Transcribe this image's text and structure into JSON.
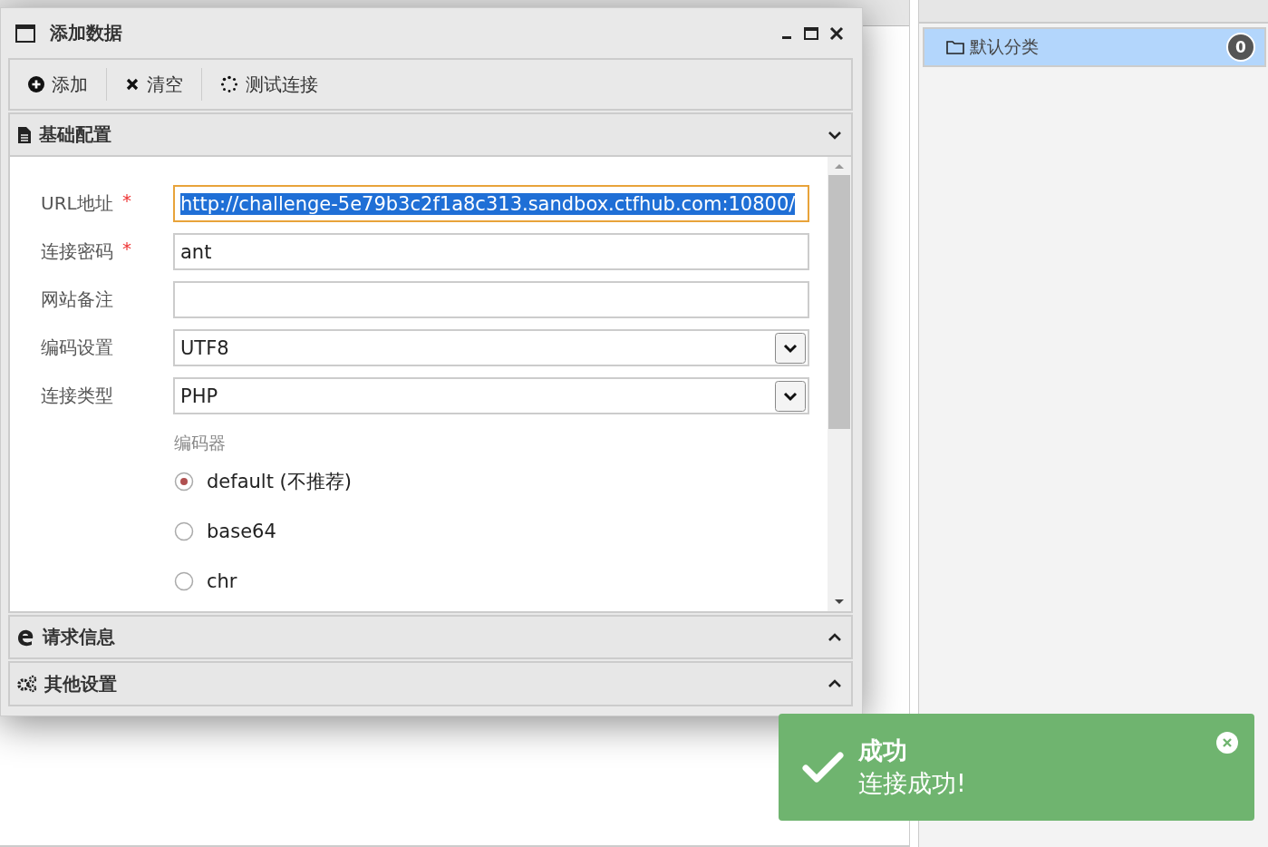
{
  "categories": [
    {
      "label": "默认分类",
      "count": "0",
      "selected": true
    }
  ],
  "dialog": {
    "title": "添加数据",
    "toolbar": [
      {
        "label": "添加"
      },
      {
        "label": "清空"
      },
      {
        "label": "测试连接"
      }
    ],
    "sections": [
      {
        "title": "基础配置",
        "expanded": true
      },
      {
        "title": "请求信息",
        "expanded": false
      },
      {
        "title": "其他设置",
        "expanded": false
      }
    ],
    "fields": [
      {
        "label": "URL地址",
        "required_mark": "*",
        "kind": "text",
        "value": "http://challenge-5e79b3c2f1a8c313.sandbox.ctfhub.com:10800/",
        "focused": true
      },
      {
        "label": "连接密码",
        "required_mark": "*",
        "kind": "text",
        "value": "ant",
        "focused": false
      },
      {
        "label": "网站备注",
        "kind": "text",
        "focused": false
      },
      {
        "label": "编码设置",
        "kind": "select",
        "value": "UTF8",
        "focused": false
      },
      {
        "label": "连接类型",
        "kind": "select",
        "value": "PHP",
        "focused": false
      }
    ],
    "encoder": {
      "label": "编码器",
      "options": [
        {
          "label": "default (不推荐)",
          "selected": true
        },
        {
          "label": "base64",
          "selected": false
        },
        {
          "label": "chr",
          "selected": false
        }
      ]
    }
  },
  "toast": {
    "title": "成功",
    "message": "连接成功!"
  }
}
